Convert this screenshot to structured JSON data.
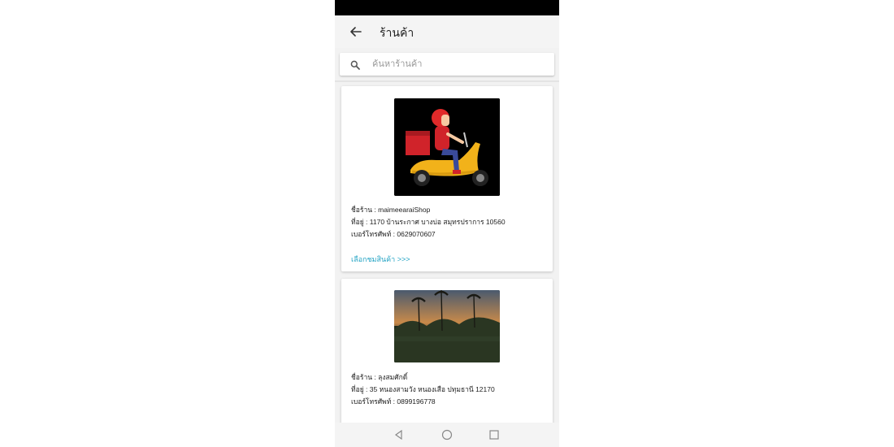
{
  "appbar": {
    "title": "ร้านค้า",
    "back_icon": "arrow-back-icon"
  },
  "search": {
    "placeholder": "ค้นหาร้านค้า",
    "value": "",
    "icon": "search-icon"
  },
  "shops": [
    {
      "name_line": "ชื่อร้าน : maimeearaiShop",
      "address_line": "ที่อยู่ : 1170 บ้านระกาศ บางบ่อ สมุทรปราการ 10560",
      "phone_line": "เบอร์โทรศัพท์ : 0629070607",
      "link_label": "เลือกชมสินค้า >>>"
    },
    {
      "name_line": "ชื่อร้าน : ลุงสมศักดิ์",
      "address_line": "ที่อยู่ : 35 หนองสามวัง หนองเสือ ปทุมธานี 12170",
      "phone_line": "เบอร์โทรศัพท์ : 0899196778"
    }
  ],
  "navbar": {
    "icons": [
      "nav-back-icon",
      "nav-home-icon",
      "nav-recents-icon"
    ]
  },
  "colors": {
    "link": "#22a3c4",
    "statusbar": "#000000",
    "appbar": "#f4f4f4"
  }
}
